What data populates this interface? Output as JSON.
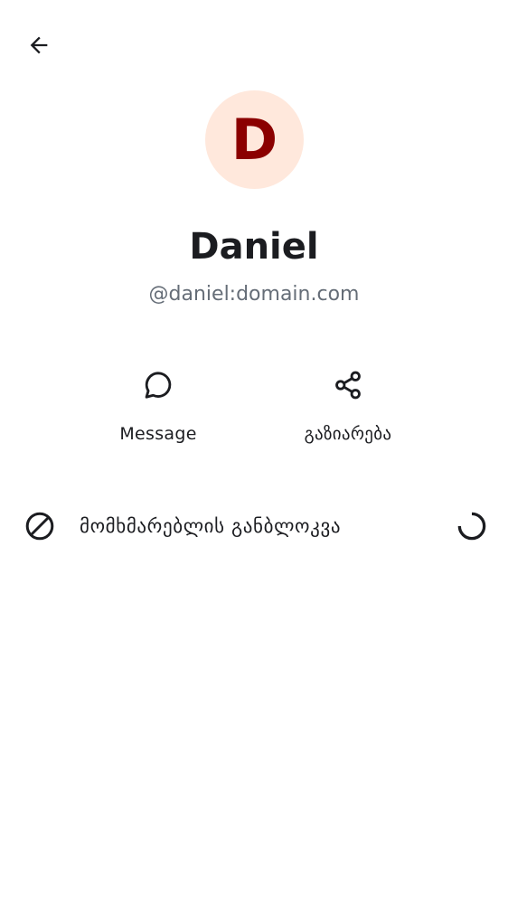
{
  "colors": {
    "background": "#ffffff",
    "text_primary": "#1b1c20",
    "text_secondary": "#656d77",
    "avatar_background": "#ffe8dc",
    "avatar_letter": "#8b0000"
  },
  "header": {
    "back_icon": "arrow-left-icon"
  },
  "profile": {
    "avatar_initial": "D",
    "display_name": "Daniel",
    "user_id": "@daniel:domain.com"
  },
  "actions": [
    {
      "icon": "chat-bubble-icon",
      "label": "Message"
    },
    {
      "icon": "share-icon",
      "label": "გაზიარება"
    }
  ],
  "block": {
    "icon": "block-icon",
    "label": "მომხმარებლის განბლოკვა",
    "status_icon": "loading-spinner-icon"
  }
}
